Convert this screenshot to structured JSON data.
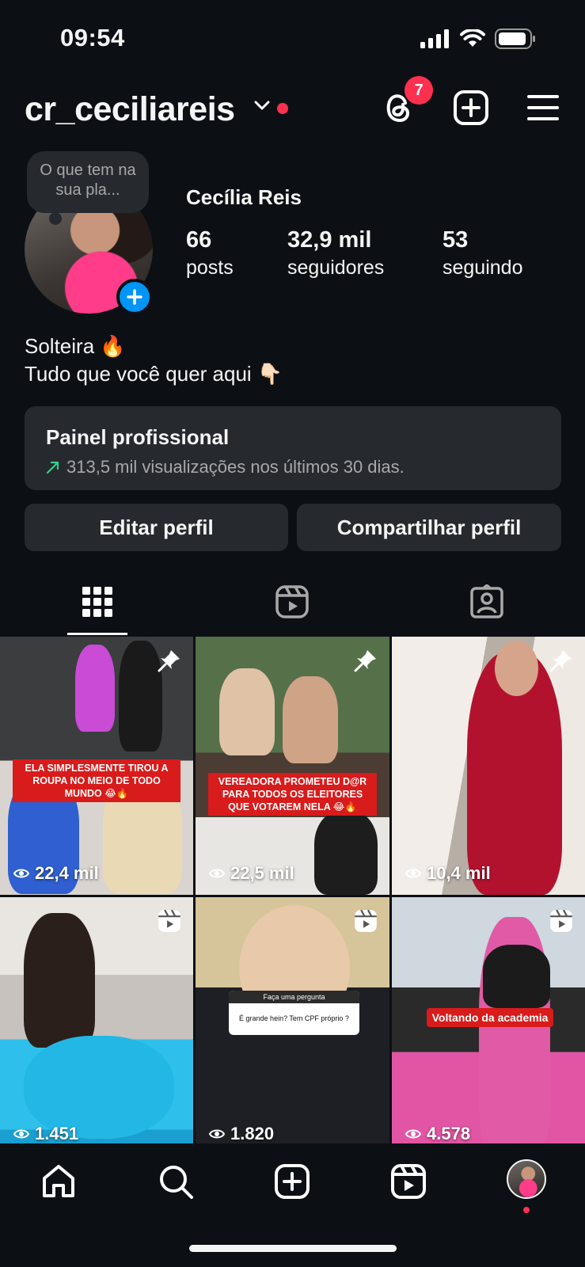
{
  "status_bar": {
    "time": "09:54"
  },
  "header": {
    "username": "cr_ceciliareis",
    "threads_badge": "7",
    "icons": [
      "chevron-down-icon",
      "threads-icon",
      "add-post-icon",
      "menu-icon"
    ]
  },
  "profile": {
    "note": "O que tem na sua pla...",
    "full_name": "Cecília Reis",
    "stats": {
      "posts_value": "66",
      "posts_label": "posts",
      "followers_value": "32,9 mil",
      "followers_label": "seguidores",
      "following_value": "53",
      "following_label": "seguindo"
    },
    "bio_line1": "Solteira 🔥",
    "bio_line2": "Tudo que você quer aqui 👇🏻"
  },
  "pro_dashboard": {
    "title": "Painel profissional",
    "subtitle": "313,5 mil visualizações nos últimos 30 dias."
  },
  "buttons": {
    "edit": "Editar perfil",
    "share": "Compartilhar perfil"
  },
  "tabs": [
    "grid-icon",
    "reels-icon",
    "tagged-icon"
  ],
  "posts": [
    {
      "views": "22,4 mil",
      "pinned": true,
      "caption": "ELA SIMPLESMENTE TIROU A ROUPA NO MEIO DE TODO MUNDO 😂🔥"
    },
    {
      "views": "22,5 mil",
      "pinned": true,
      "caption": "VEREADORA PROMETEU D@R PARA TODOS OS ELEITORES QUE VOTAREM NELA 😂🔥"
    },
    {
      "views": "10,4 mil",
      "pinned": true
    },
    {
      "views": "1.451",
      "reel": true
    },
    {
      "views": "1.820",
      "reel": true,
      "card_header": "Faça uma pergunta",
      "card_question": "É grande hein? Tem CPF próprio ?"
    },
    {
      "views": "4.578",
      "reel": true,
      "caption": "Voltando da academia"
    }
  ],
  "colors": {
    "background": "#0c1014",
    "surface": "#262a2f",
    "accent": "#0095f6",
    "notification": "#ff2f4f",
    "positive": "#35d08a"
  }
}
